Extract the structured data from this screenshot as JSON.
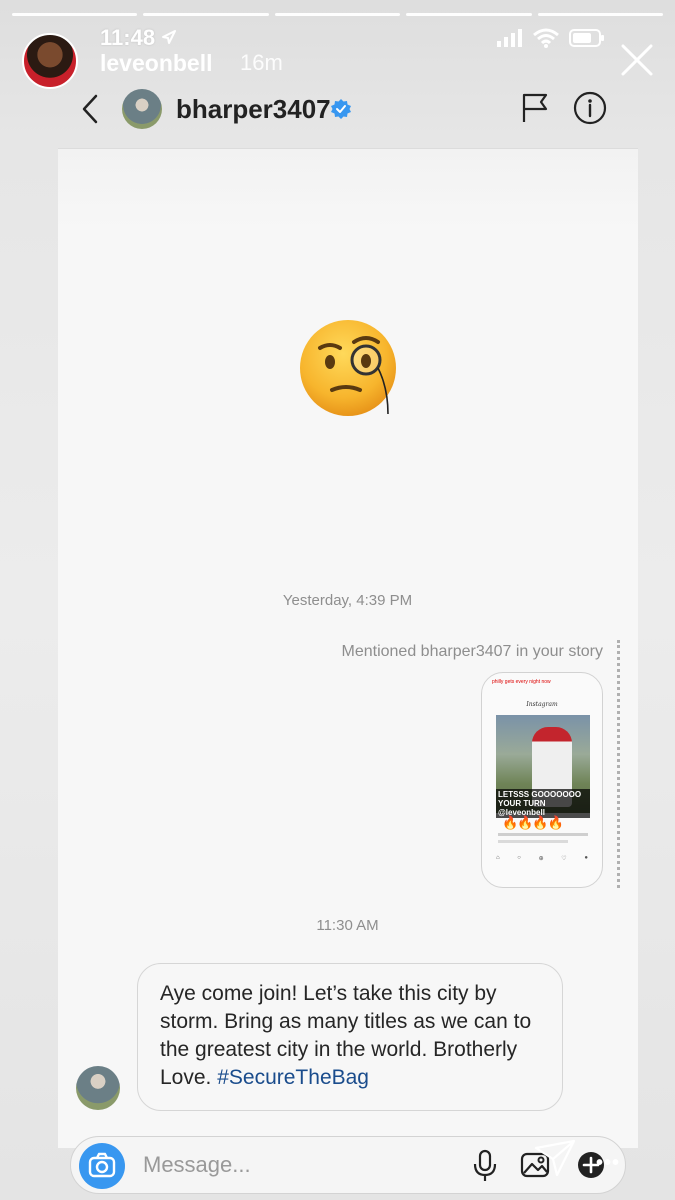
{
  "story": {
    "progress_segments": 5,
    "progress_done": 5,
    "time": "11:48",
    "username": "leveonbell",
    "age": "16m"
  },
  "dm": {
    "header_username": "bharper3407",
    "timestamp_1": "Yesterday, 4:39 PM",
    "mention_label": "Mentioned bharper3407 in your story",
    "timestamp_2": "11:30 AM",
    "message_text": "Aye come join! Let’s take this city by storm. Bring as many titles as we can to the greatest city in the world. Brotherly Love. ",
    "message_hashtag": "#SecureTheBag",
    "composer_placeholder": "Message...",
    "thumbnail": {
      "caption": "philly gets every night now",
      "app_name": "Instagram",
      "banner_line1": "LETSSS GOOOOOOO",
      "banner_line2": "YOUR TURN @leveonbell",
      "fire": "🔥🔥🔥🔥"
    }
  },
  "icons": {
    "story_close": "close-icon",
    "back": "chevron-left-icon",
    "verified": "verified-badge-icon",
    "flag": "flag-icon",
    "info": "info-icon",
    "camera": "camera-icon",
    "mic": "microphone-icon",
    "gallery": "gallery-icon",
    "add": "plus-circle-icon",
    "send": "send-icon",
    "more": "more-icon"
  },
  "colors": {
    "accent_blue": "#3897f0",
    "hashtag": "#1a4c8c",
    "verified": "#3897f0"
  }
}
